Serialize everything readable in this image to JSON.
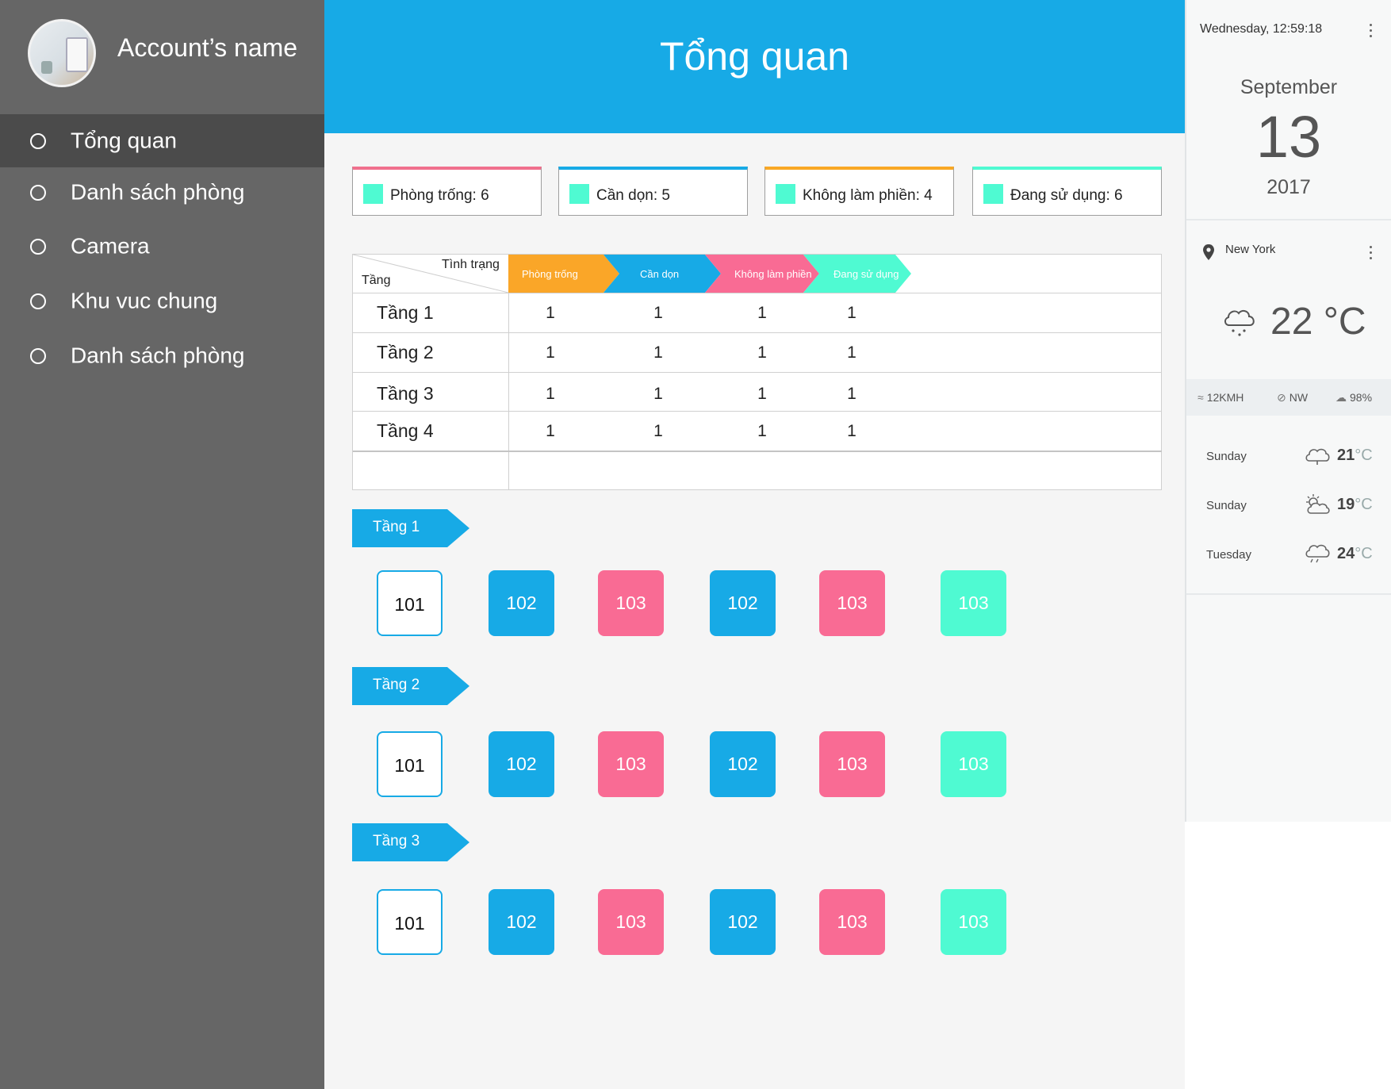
{
  "sidebar": {
    "account_name": "Account’s name",
    "items": [
      {
        "label": "Tổng quan",
        "active": true
      },
      {
        "label": "Danh sách phòng",
        "active": false
      },
      {
        "label": "Camera",
        "active": false
      },
      {
        "label": "Khu vuc chung",
        "active": false
      },
      {
        "label": "Danh sách phòng",
        "active": false
      }
    ]
  },
  "header": {
    "title": "Tổng quan"
  },
  "summary": [
    {
      "label": "Phòng trống: 6",
      "color": "#f0708d",
      "swatch": "#4ffad2"
    },
    {
      "label": "Cần dọn: 5",
      "color": "#17aae6",
      "swatch": "#4ffad2"
    },
    {
      "label": "Không làm phiền: 4",
      "color": "#f9a825",
      "swatch": "#4ffad2"
    },
    {
      "label": "Đang sử dụng: 6",
      "color": "#4ffad2",
      "swatch": "#4ffad2"
    }
  ],
  "table": {
    "header_status": "Tình trạng",
    "header_floor": "Tầng",
    "statuses": [
      {
        "label": "Phòng trống",
        "color": "#faa628"
      },
      {
        "label": "Cần dọn",
        "color": "#17aae6"
      },
      {
        "label": "Không làm phiền",
        "color": "#f96b94"
      },
      {
        "label": "Đang sử dụng",
        "color": "#4ffad2"
      }
    ],
    "rows": [
      {
        "floor": "Tầng 1",
        "values": [
          "1",
          "1",
          "1",
          "1"
        ]
      },
      {
        "floor": "Tầng 2",
        "values": [
          "1",
          "1",
          "1",
          "1"
        ]
      },
      {
        "floor": "Tầng 3",
        "values": [
          "1",
          "1",
          "1",
          "1"
        ]
      },
      {
        "floor": "Tầng 4",
        "values": [
          "1",
          "1",
          "1",
          "1"
        ]
      }
    ]
  },
  "floors": [
    {
      "label": "Tầng 1",
      "rooms": [
        {
          "number": "101",
          "status": "vacant"
        },
        {
          "number": "102",
          "status": "cleaning"
        },
        {
          "number": "103",
          "status": "dnd"
        },
        {
          "number": "102",
          "status": "cleaning"
        },
        {
          "number": "103",
          "status": "dnd"
        },
        {
          "number": "103",
          "status": "occupied"
        }
      ]
    },
    {
      "label": "Tầng  2",
      "rooms": [
        {
          "number": "101",
          "status": "vacant"
        },
        {
          "number": "102",
          "status": "cleaning"
        },
        {
          "number": "103",
          "status": "dnd"
        },
        {
          "number": "102",
          "status": "cleaning"
        },
        {
          "number": "103",
          "status": "dnd"
        },
        {
          "number": "103",
          "status": "occupied"
        }
      ]
    },
    {
      "label": "Tầng 3",
      "rooms": [
        {
          "number": "101",
          "status": "vacant"
        },
        {
          "number": "102",
          "status": "cleaning"
        },
        {
          "number": "103",
          "status": "dnd"
        },
        {
          "number": "102",
          "status": "cleaning"
        },
        {
          "number": "103",
          "status": "dnd"
        },
        {
          "number": "103",
          "status": "occupied"
        }
      ]
    }
  ],
  "widget": {
    "clock": "Wednesday, 12:59:18",
    "month": "September",
    "day": "13",
    "year": "2017",
    "city": "New York",
    "temperature": "22 °C",
    "wind_speed": "12KMH",
    "wind_dir": "NW",
    "humidity": "98%",
    "forecast": [
      {
        "day": "Sunday",
        "temp": "21",
        "unit": "°C",
        "icon": "cloud-icon"
      },
      {
        "day": "Sunday",
        "temp": "19",
        "unit": "°C",
        "icon": "partly-sunny-icon"
      },
      {
        "day": "Tuesday",
        "temp": "24",
        "unit": "°C",
        "icon": "rain-icon"
      }
    ]
  },
  "colors": {
    "accent": "#17aae6",
    "sidebar": "#666666",
    "sidebar_active": "#4b4b4b",
    "vacant_border": "#17aae6",
    "cleaning": "#17aae6",
    "dnd": "#f96b94",
    "occupied": "#4ffad2"
  }
}
